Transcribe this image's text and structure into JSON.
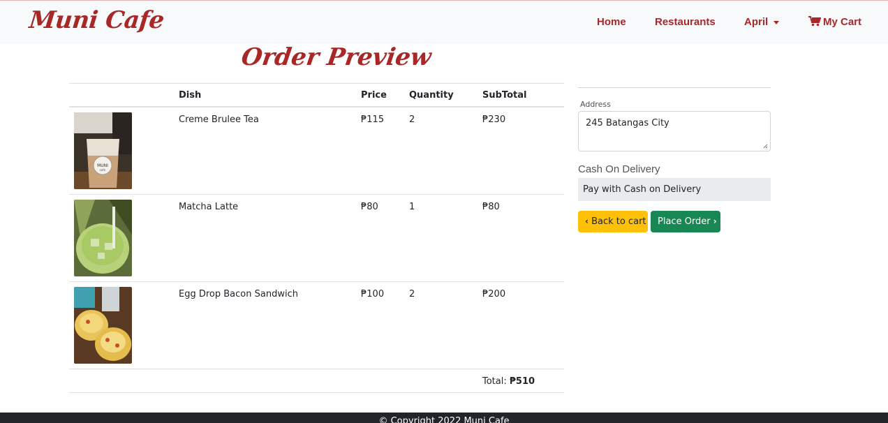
{
  "brand": "Muni Cafe",
  "nav": {
    "home": "Home",
    "restaurants": "Restaurants",
    "user": "April",
    "cart": "My Cart"
  },
  "page_title": "Order Preview",
  "table": {
    "headers": [
      "",
      "Dish",
      "Price",
      "Quantity",
      "SubTotal"
    ],
    "rows": [
      {
        "dish": "Creme Brulee Tea",
        "price": "₱115",
        "qty": "2",
        "subtotal": "₱230",
        "image": "creme-brulee-tea-photo"
      },
      {
        "dish": "Matcha Latte",
        "price": "₱80",
        "qty": "1",
        "subtotal": "₱80",
        "image": "matcha-latte-photo"
      },
      {
        "dish": "Egg Drop Bacon Sandwich",
        "price": "₱100",
        "qty": "2",
        "subtotal": "₱200",
        "image": "egg-drop-sandwich-photo"
      }
    ],
    "total_label": "Total:",
    "total_value": "₱510"
  },
  "checkout": {
    "address_label": "Address",
    "address_value": "245 Batangas City",
    "payment_title": "Cash On Delivery",
    "payment_option": "Pay with Cash on Delivery",
    "back_button": "Back to cart",
    "place_button": "Place Order"
  },
  "footer": "© Copyright 2022 Muni Cafe",
  "colors": {
    "brand": "#a82828",
    "warning": "#ffc107",
    "success": "#198754"
  }
}
